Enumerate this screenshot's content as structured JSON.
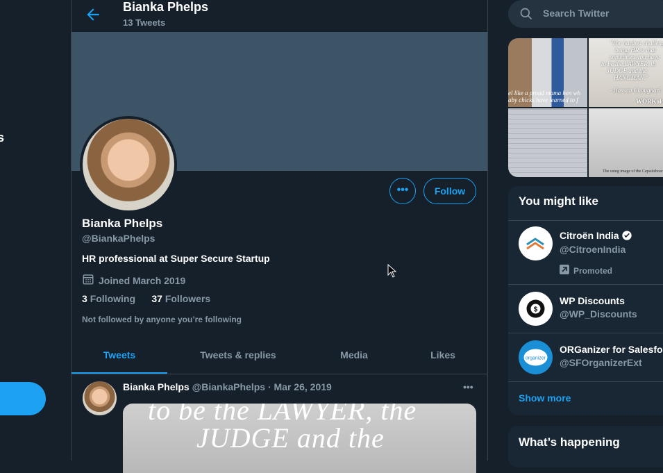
{
  "nav": {
    "fragment_label": "s"
  },
  "header": {
    "title": "Bianka Phelps",
    "tweet_count": "13 Tweets"
  },
  "profile": {
    "name": "Bianka Phelps",
    "handle": "@BiankaPhelps",
    "bio": "HR professional at Super Secure Startup",
    "joined": "Joined March 2019",
    "following_count": "3",
    "following_label": "Following",
    "followers_count": "37",
    "followers_label": "Followers",
    "not_followed": "Not followed by anyone you’re following",
    "follow_button": "Follow",
    "more_button": "•••"
  },
  "tabs": [
    {
      "label": "Tweets",
      "active": true
    },
    {
      "label": "Tweets & replies",
      "active": false
    },
    {
      "label": "Media",
      "active": false
    },
    {
      "label": "Likes",
      "active": false
    }
  ],
  "tweet": {
    "name": "Bianka Phelps",
    "handle": "@BiankaPhelps",
    "separator": "·",
    "date": "Mar 26, 2019",
    "more": "•••",
    "image_text_line1": "to be the LAWYER, the",
    "image_text_line2": "JUDGE and the"
  },
  "right": {
    "search_placeholder": "Search Twitter",
    "media_captions": {
      "m1": "el like a proud mama hen wh",
      "m1b": "aby chicks have learned to f",
      "m2a": "\"The hardest challeng",
      "m2b": "being HR is that",
      "m2c": "sometimes you have",
      "m2d": "to be the LAWYER, th",
      "m2e": "JUDGE and the",
      "m2f": "HANGMAN.\"",
      "m2g": "- Hassan Choughari",
      "m2h": "WORKology",
      "m4": "The using image of the Capsuleboar"
    },
    "who_to_follow": {
      "title": "You might like",
      "accounts": [
        {
          "name": "Citroën India",
          "handle": "@CitroenIndia",
          "verified": true,
          "promoted": "Promoted"
        },
        {
          "name": "WP Discounts",
          "handle": "@WP_Discounts"
        },
        {
          "name": "ORGanizer for Salesfo",
          "handle": "@SFOrganizerExt",
          "avatar_text": "organizer"
        }
      ],
      "show_more": "Show more"
    },
    "whats_happening": "What’s happening"
  },
  "colors": {
    "accent": "#1da1f2",
    "background": "#15202b",
    "card": "#192734",
    "muted": "#8899a6"
  }
}
